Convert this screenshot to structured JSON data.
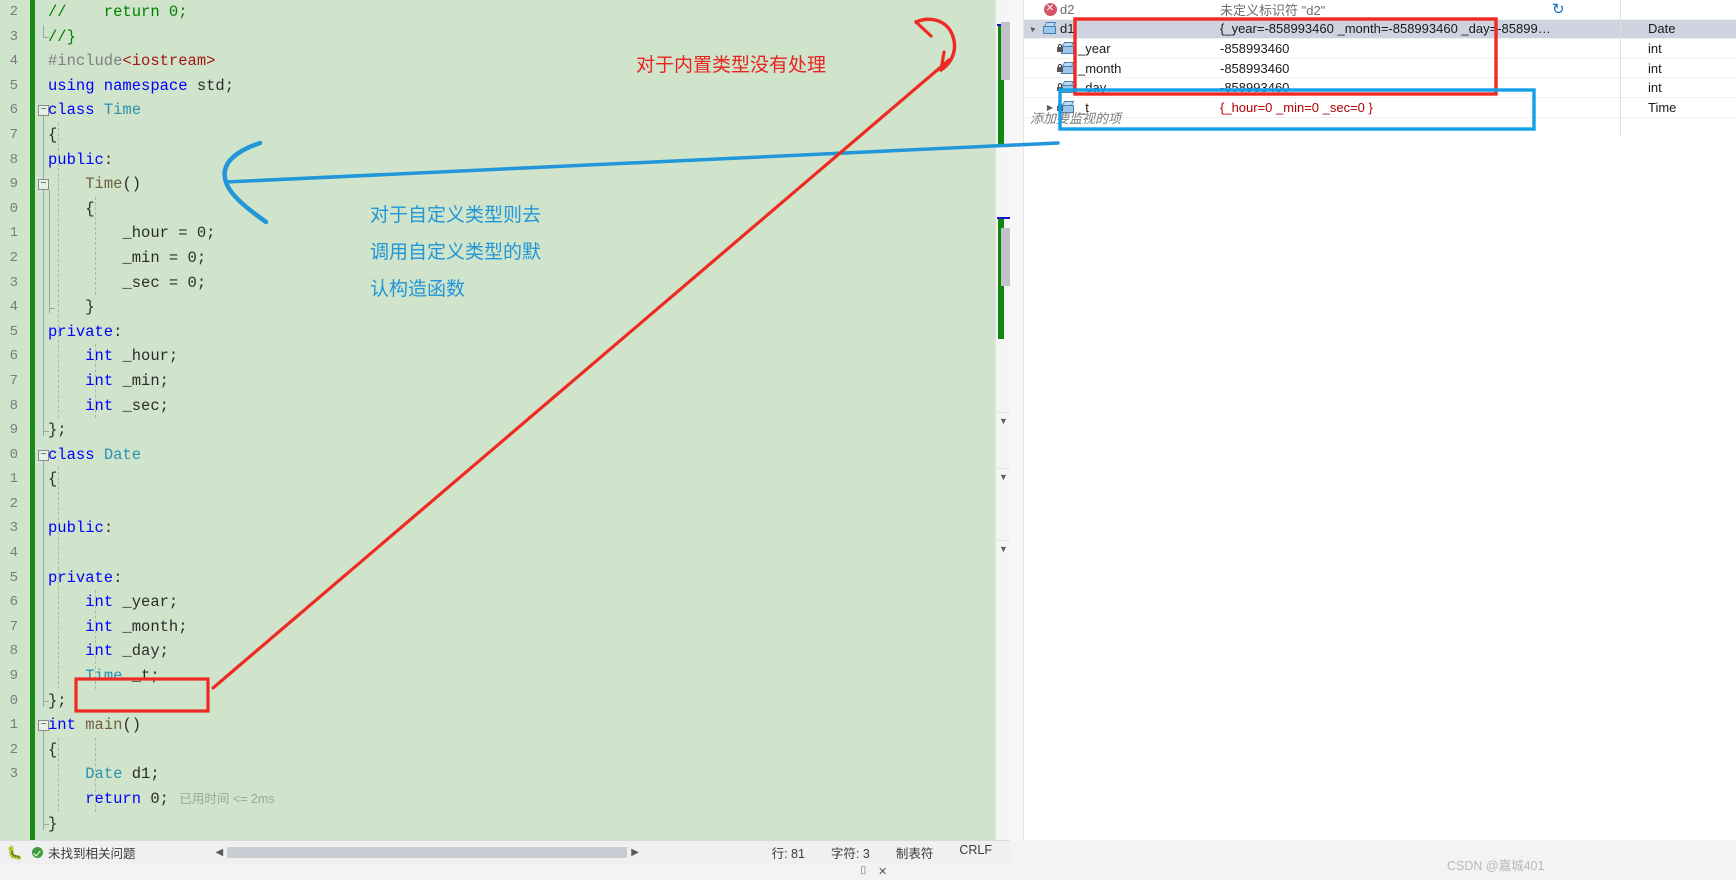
{
  "editor": {
    "language": "cpp",
    "gutter_numbers": [
      "2",
      "3",
      "4",
      "5",
      "6",
      "7",
      "8",
      "9",
      "0",
      "1",
      "2",
      "3",
      "4",
      "5",
      "6",
      "7",
      "8",
      "9",
      "0",
      "1",
      "2",
      "3",
      "4",
      "5",
      "6",
      "7",
      "8",
      "9",
      "0",
      "1",
      "2",
      "3"
    ],
    "lines": [
      {
        "indent": 0,
        "segments": [
          {
            "t": "//    return 0;",
            "c": "cmt"
          }
        ]
      },
      {
        "indent": 0,
        "segments": [
          {
            "t": "//}",
            "c": "cmt"
          }
        ]
      },
      {
        "indent": 0,
        "segments": [
          {
            "t": "#include",
            "c": "pre"
          },
          {
            "t": "<iostream>",
            "c": "str"
          }
        ]
      },
      {
        "indent": 0,
        "segments": [
          {
            "t": "using namespace",
            "c": "kw"
          },
          {
            "t": " std;",
            "c": "pln"
          }
        ]
      },
      {
        "indent": 0,
        "segments": [
          {
            "t": "class",
            "c": "kw"
          },
          {
            "t": " ",
            "c": "pln"
          },
          {
            "t": "Time",
            "c": "type"
          }
        ]
      },
      {
        "indent": 0,
        "segments": [
          {
            "t": "{",
            "c": "pln"
          }
        ]
      },
      {
        "indent": 0,
        "segments": [
          {
            "t": "public",
            "c": "kw"
          },
          {
            "t": ":",
            "c": "pln"
          }
        ]
      },
      {
        "indent": 1,
        "segments": [
          {
            "t": "Time",
            "c": "fn"
          },
          {
            "t": "()",
            "c": "pln"
          }
        ]
      },
      {
        "indent": 1,
        "segments": [
          {
            "t": "{",
            "c": "pln"
          }
        ]
      },
      {
        "indent": 2,
        "segments": [
          {
            "t": "_hour = 0;",
            "c": "pln"
          }
        ]
      },
      {
        "indent": 2,
        "segments": [
          {
            "t": "_min = 0;",
            "c": "pln"
          }
        ]
      },
      {
        "indent": 2,
        "segments": [
          {
            "t": "_sec = 0;",
            "c": "pln"
          }
        ]
      },
      {
        "indent": 1,
        "segments": [
          {
            "t": "}",
            "c": "pln"
          }
        ]
      },
      {
        "indent": 0,
        "segments": [
          {
            "t": "private",
            "c": "kw"
          },
          {
            "t": ":",
            "c": "pln"
          }
        ]
      },
      {
        "indent": 1,
        "segments": [
          {
            "t": "int",
            "c": "kw"
          },
          {
            "t": " _hour;",
            "c": "pln"
          }
        ]
      },
      {
        "indent": 1,
        "segments": [
          {
            "t": "int",
            "c": "kw"
          },
          {
            "t": " _min;",
            "c": "pln"
          }
        ]
      },
      {
        "indent": 1,
        "segments": [
          {
            "t": "int",
            "c": "kw"
          },
          {
            "t": " _sec;",
            "c": "pln"
          }
        ]
      },
      {
        "indent": 0,
        "segments": [
          {
            "t": "};",
            "c": "pln"
          }
        ]
      },
      {
        "indent": 0,
        "segments": [
          {
            "t": "class",
            "c": "kw"
          },
          {
            "t": " ",
            "c": "pln"
          },
          {
            "t": "Date",
            "c": "type"
          }
        ]
      },
      {
        "indent": 0,
        "segments": [
          {
            "t": "{",
            "c": "pln"
          }
        ]
      },
      {
        "indent": 0,
        "segments": []
      },
      {
        "indent": 0,
        "segments": [
          {
            "t": "public",
            "c": "kw"
          },
          {
            "t": ":",
            "c": "pln"
          }
        ]
      },
      {
        "indent": 0,
        "segments": []
      },
      {
        "indent": 0,
        "segments": [
          {
            "t": "private",
            "c": "kw"
          },
          {
            "t": ":",
            "c": "pln"
          }
        ]
      },
      {
        "indent": 1,
        "segments": [
          {
            "t": "int",
            "c": "kw"
          },
          {
            "t": " _year;",
            "c": "pln"
          }
        ]
      },
      {
        "indent": 1,
        "segments": [
          {
            "t": "int",
            "c": "kw"
          },
          {
            "t": " _month;",
            "c": "pln"
          }
        ]
      },
      {
        "indent": 1,
        "segments": [
          {
            "t": "int",
            "c": "kw"
          },
          {
            "t": " _day;",
            "c": "pln"
          }
        ]
      },
      {
        "indent": 1,
        "segments": [
          {
            "t": "Time",
            "c": "type"
          },
          {
            "t": " _t;",
            "c": "pln"
          }
        ]
      },
      {
        "indent": 0,
        "segments": [
          {
            "t": "};",
            "c": "pln"
          }
        ]
      },
      {
        "indent": 0,
        "segments": [
          {
            "t": "int",
            "c": "kw"
          },
          {
            "t": " ",
            "c": "pln"
          },
          {
            "t": "main",
            "c": "fn"
          },
          {
            "t": "()",
            "c": "pln"
          }
        ]
      },
      {
        "indent": 0,
        "segments": [
          {
            "t": "{",
            "c": "pln"
          }
        ]
      },
      {
        "indent": 1,
        "segments": [
          {
            "t": "Date",
            "c": "type"
          },
          {
            "t": " d1;",
            "c": "pln"
          }
        ]
      },
      {
        "indent": 1,
        "segments": [
          {
            "t": "return",
            "c": "kw"
          },
          {
            "t": " 0;",
            "c": "pln"
          }
        ]
      },
      {
        "indent": 0,
        "segments": [
          {
            "t": "}",
            "c": "pln"
          }
        ]
      }
    ],
    "elapsed_hint": "已用时间 <= 2ms"
  },
  "status_bar": {
    "problems_label": "未找到相关问题",
    "line_label": "行: 81",
    "char_label": "字符: 3",
    "tab_label": "制表符",
    "eol_label": "CRLF",
    "scroll_left_arrow": "◀",
    "scroll_right_arrow": "▶"
  },
  "watch_window": {
    "rows": [
      {
        "name": "d2",
        "value": "未定义标识符 \"d2\"",
        "type": "",
        "indent": 0,
        "expander": "",
        "icon": "error-icon",
        "value_style": "gray",
        "name_style": "gray",
        "selected": false
      },
      {
        "name": "d1",
        "value": "{_year=-858993460 _month=-858993460 _day=-85899…",
        "type": "Date",
        "indent": 0,
        "expander": "▲",
        "icon": "cube-icon",
        "value_style": "normal",
        "name_style": "normal",
        "selected": true
      },
      {
        "name": "_year",
        "value": "-858993460",
        "type": "int",
        "indent": 1,
        "expander": "",
        "icon": "locked-cube-icon",
        "value_style": "normal",
        "name_style": "normal",
        "selected": false
      },
      {
        "name": "_month",
        "value": "-858993460",
        "type": "int",
        "indent": 1,
        "expander": "",
        "icon": "locked-cube-icon",
        "value_style": "normal",
        "name_style": "normal",
        "selected": false
      },
      {
        "name": "_day",
        "value": "-858993460",
        "type": "int",
        "indent": 1,
        "expander": "",
        "icon": "locked-cube-icon",
        "value_style": "normal",
        "name_style": "normal",
        "selected": false
      },
      {
        "name": "_t",
        "value": "{_hour=0 _min=0 _sec=0 }",
        "type": "Time",
        "indent": 1,
        "expander": "▶",
        "icon": "locked-cube-icon",
        "value_style": "red",
        "name_style": "normal",
        "selected": false
      }
    ],
    "add_watch_placeholder": "添加要监视的项",
    "refresh_icon": "↻"
  },
  "annotations": {
    "red_note": "对于内置类型没有处理",
    "blue_note_lines": [
      "对于自定义类型则去",
      "调用自定义类型的默",
      "认构造函数"
    ],
    "red_color": "#e8241f",
    "blue_color": "#2196d8"
  },
  "watermark": "CSDN @嘉城401"
}
